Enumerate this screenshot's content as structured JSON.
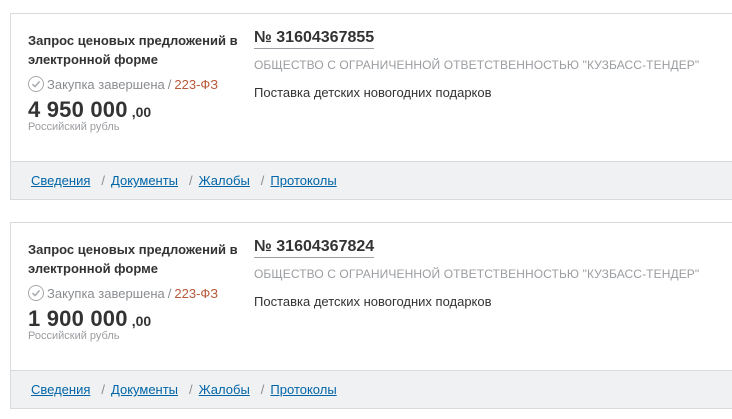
{
  "cards": [
    {
      "procedure_type": "Запрос ценовых предложений в электронной форме",
      "status": "Закупка завершена",
      "law": "223-ФЗ",
      "price_int": "4 950 000",
      "price_frac": ",00",
      "currency": "Российский рубль",
      "reg_number": "№ 31604367855",
      "organization": "ОБЩЕСТВО С ОГРАНИЧЕННОЙ ОТВЕТСТВЕННОСТЬЮ \"КУЗБАСС-ТЕНДЕР\"",
      "subject": "Поставка детских новогодних подарков",
      "tabs": [
        "Сведения",
        "Документы",
        "Жалобы",
        "Протоколы"
      ]
    },
    {
      "procedure_type": "Запрос ценовых предложений в электронной форме",
      "status": "Закупка завершена",
      "law": "223-ФЗ",
      "price_int": "1 900 000",
      "price_frac": ",00",
      "currency": "Российский рубль",
      "reg_number": "№ 31604367824",
      "organization": "ОБЩЕСТВО С ОГРАНИЧЕННОЙ ОТВЕТСТВЕННОСТЬЮ \"КУЗБАСС-ТЕНДЕР\"",
      "subject": "Поставка детских новогодних подарков",
      "tabs": [
        "Сведения",
        "Документы",
        "Жалобы",
        "Протоколы"
      ]
    }
  ],
  "slash": "/",
  "icons": {
    "status": "check-circle-icon"
  },
  "colors": {
    "link": "#0065a8",
    "law": "#b8583a",
    "footer_bg": "#eff1f3"
  }
}
